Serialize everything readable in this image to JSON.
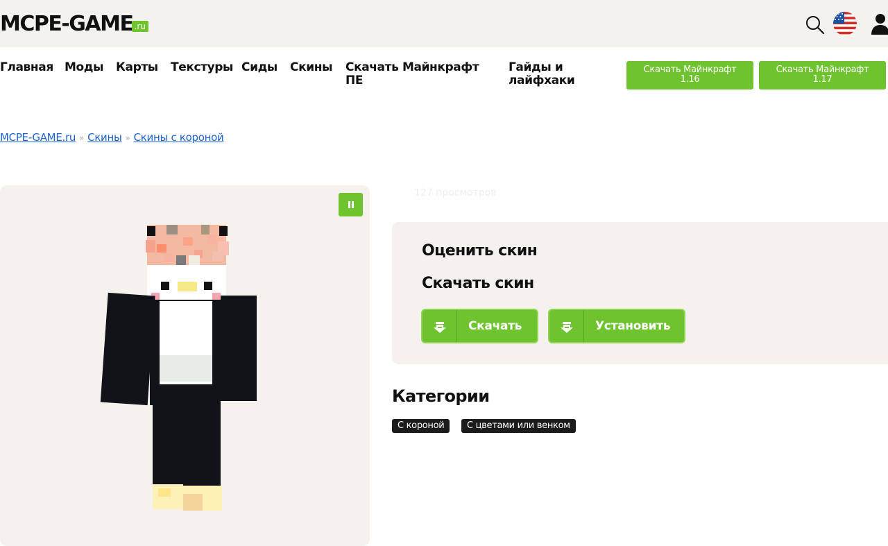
{
  "site": {
    "logo_main": "MCPE-GAME",
    "logo_suffix": ".ru"
  },
  "header_icons": [
    "search-icon",
    "us-flag-icon",
    "user-icon"
  ],
  "nav": {
    "items": [
      {
        "label": "Главная"
      },
      {
        "label": "Моды"
      },
      {
        "label": "Карты"
      },
      {
        "label": "Текстуры"
      },
      {
        "label": "Сиды"
      },
      {
        "label": "Скины"
      },
      {
        "label": "Скачать Майнкрафт ПЕ"
      },
      {
        "label": "Гайды и лайфхаки"
      }
    ],
    "download_buttons": [
      {
        "line1": "Скачать Майнкрафт",
        "line2": "1.16"
      },
      {
        "line1": "Скачать Майнкрафт",
        "line2": "1.17"
      }
    ]
  },
  "breadcrumb": {
    "items": [
      "MCPE-GAME.ru",
      "Скины",
      "Скины с короной"
    ],
    "separator": "»"
  },
  "skin": {
    "views": "127 просмотров",
    "pause_icon": "pause-icon"
  },
  "panel": {
    "rate_title": "Оценить скин",
    "download_title": "Скачать скин",
    "download_button": "Скачать",
    "install_button": "Установить"
  },
  "categories": {
    "title": "Категории",
    "tags": [
      "С короной",
      "С цветами или венком"
    ]
  },
  "colors": {
    "accent": "#6fc32e",
    "link": "#1a64d6",
    "panel_bg": "#f5f2ee",
    "header_bg": "#f4f2ee",
    "tag_bg": "#1b1b1b"
  }
}
